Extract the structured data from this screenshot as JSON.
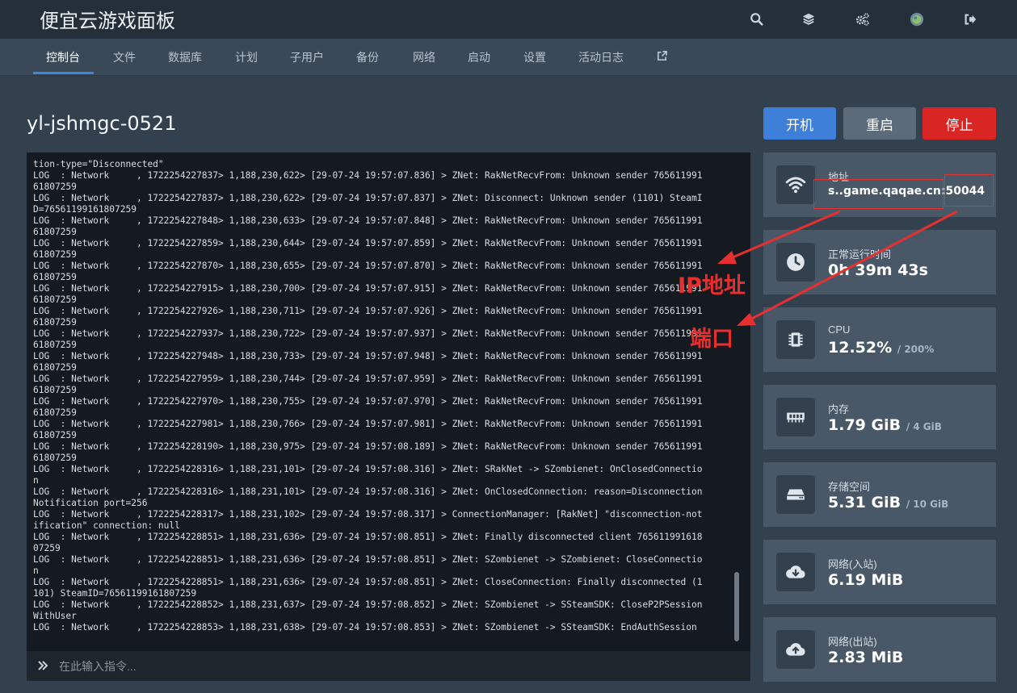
{
  "header": {
    "brand": "便宜云游戏面板",
    "icons": [
      "search-icon",
      "layers-icon",
      "cogs-icon",
      "avatar",
      "logout-icon"
    ]
  },
  "nav": {
    "tabs": [
      "控制台",
      "文件",
      "数据库",
      "计划",
      "子用户",
      "备份",
      "网络",
      "启动",
      "设置",
      "活动日志"
    ],
    "active": "控制台",
    "external_icon": "external-link-icon"
  },
  "server": {
    "name": "yl-jshmgc-0521"
  },
  "controls": {
    "start": "开机",
    "restart": "重启",
    "stop": "停止"
  },
  "console": {
    "lines": [
      "tion-type=\"Disconnected\"",
      "LOG  : Network     , 1722254227837> 1,188,230,622> [29-07-24 19:57:07.836] > ZNet: RakNetRecvFrom: Unknown sender 765611991",
      "61807259",
      "LOG  : Network     , 1722254227837> 1,188,230,622> [29-07-24 19:57:07.837] > ZNet: Disconnect: Unknown sender (1101) SteamI",
      "D=76561199161807259",
      "LOG  : Network     , 1722254227848> 1,188,230,633> [29-07-24 19:57:07.848] > ZNet: RakNetRecvFrom: Unknown sender 765611991",
      "61807259",
      "LOG  : Network     , 1722254227859> 1,188,230,644> [29-07-24 19:57:07.859] > ZNet: RakNetRecvFrom: Unknown sender 765611991",
      "61807259",
      "LOG  : Network     , 1722254227870> 1,188,230,655> [29-07-24 19:57:07.870] > ZNet: RakNetRecvFrom: Unknown sender 765611991",
      "61807259",
      "LOG  : Network     , 1722254227915> 1,188,230,700> [29-07-24 19:57:07.915] > ZNet: RakNetRecvFrom: Unknown sender 765611991",
      "61807259",
      "LOG  : Network     , 1722254227926> 1,188,230,711> [29-07-24 19:57:07.926] > ZNet: RakNetRecvFrom: Unknown sender 765611991",
      "61807259",
      "LOG  : Network     , 1722254227937> 1,188,230,722> [29-07-24 19:57:07.937] > ZNet: RakNetRecvFrom: Unknown sender 765611991",
      "61807259",
      "LOG  : Network     , 1722254227948> 1,188,230,733> [29-07-24 19:57:07.948] > ZNet: RakNetRecvFrom: Unknown sender 765611991",
      "61807259",
      "LOG  : Network     , 1722254227959> 1,188,230,744> [29-07-24 19:57:07.959] > ZNet: RakNetRecvFrom: Unknown sender 765611991",
      "61807259",
      "LOG  : Network     , 1722254227970> 1,188,230,755> [29-07-24 19:57:07.970] > ZNet: RakNetRecvFrom: Unknown sender 765611991",
      "61807259",
      "LOG  : Network     , 1722254227981> 1,188,230,766> [29-07-24 19:57:07.981] > ZNet: RakNetRecvFrom: Unknown sender 765611991",
      "61807259",
      "LOG  : Network     , 1722254228190> 1,188,230,975> [29-07-24 19:57:08.189] > ZNet: RakNetRecvFrom: Unknown sender 765611991",
      "61807259",
      "LOG  : Network     , 1722254228316> 1,188,231,101> [29-07-24 19:57:08.316] > ZNet: SRakNet -> SZombienet: OnClosedConnectio",
      "n",
      "LOG  : Network     , 1722254228316> 1,188,231,101> [29-07-24 19:57:08.316] > ZNet: OnClosedConnection: reason=Disconnection",
      "Notification port=256",
      "LOG  : Network     , 1722254228317> 1,188,231,102> [29-07-24 19:57:08.317] > ConnectionManager: [RakNet] \"disconnection-not",
      "ification\" connection: null",
      "LOG  : Network     , 1722254228851> 1,188,231,636> [29-07-24 19:57:08.851] > ZNet: Finally disconnected client 765611991618",
      "07259",
      "LOG  : Network     , 1722254228851> 1,188,231,636> [29-07-24 19:57:08.851] > ZNet: SZombienet -> SZombienet: CloseConnectio",
      "n",
      "LOG  : Network     , 1722254228851> 1,188,231,636> [29-07-24 19:57:08.851] > ZNet: CloseConnection: Finally disconnected (1",
      "101) SteamID=76561199161807259",
      "LOG  : Network     , 1722254228852> 1,188,231,637> [29-07-24 19:57:08.852] > ZNet: SZombienet -> SSteamSDK: CloseP2PSession",
      "WithUser",
      "LOG  : Network     , 1722254228853> 1,188,231,638> [29-07-24 19:57:08.853] > ZNet: SZombienet -> SSteamSDK: EndAuthSession"
    ],
    "placeholder": "在此输入指令..."
  },
  "stats": [
    {
      "label": "地址",
      "value": "s..game.qaqae.cn:50044",
      "sub": "",
      "icon": "wifi-icon"
    },
    {
      "label": "正常运行时间",
      "value": "0h 39m 43s",
      "sub": "",
      "icon": "clock-icon"
    },
    {
      "label": "CPU",
      "value": "12.52%",
      "sub": "/ 200%",
      "icon": "cpu-icon"
    },
    {
      "label": "内存",
      "value": "1.79 GiB",
      "sub": "/ 4 GiB",
      "icon": "memory-icon"
    },
    {
      "label": "存储空间",
      "value": "5.31 GiB",
      "sub": "/ 10 GiB",
      "icon": "storage-icon"
    },
    {
      "label": "网络(入站)",
      "value": "6.19 MiB",
      "sub": "",
      "icon": "cloud-download-icon"
    },
    {
      "label": "网络(出站)",
      "value": "2.83 MiB",
      "sub": "",
      "icon": "cloud-upload-icon"
    }
  ],
  "annotations": {
    "ip_label": "IP地址",
    "port_label": "端口",
    "color": "#e63030"
  },
  "colors": {
    "accent": "#3d87d6",
    "start": "#3d7fd9",
    "restart": "#5c6b79",
    "stop": "#d92624"
  }
}
